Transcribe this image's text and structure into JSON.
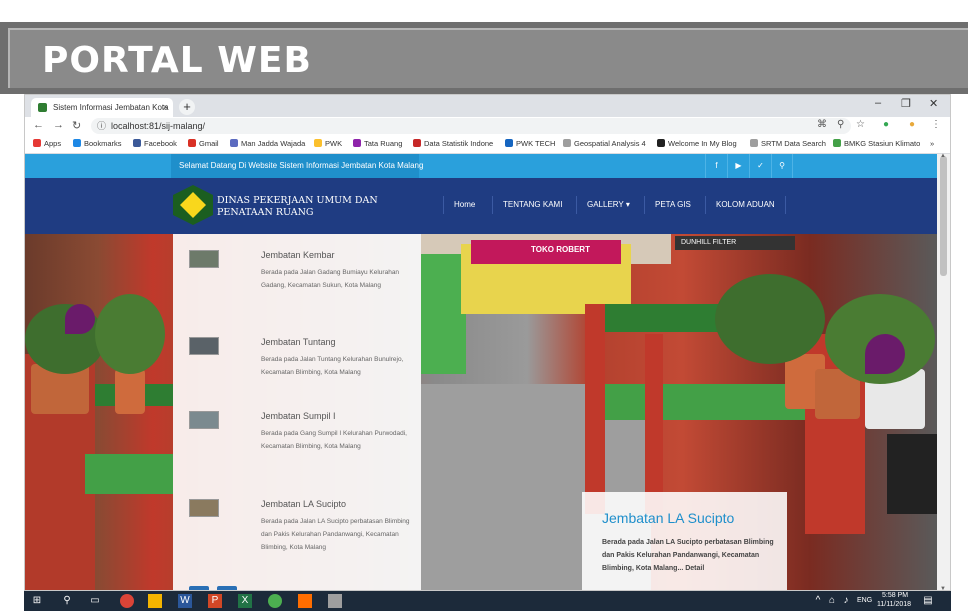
{
  "slide": {
    "title": "PORTAL WEB"
  },
  "browser": {
    "tab_title": "Sistem Informasi Jembatan Kota",
    "tab_close": "×",
    "new_tab": "+",
    "win_minimize": "–",
    "win_maximize": "❐",
    "win_close": "✕",
    "url": "localhost:81/sij-malang/",
    "bookmarks": [
      "Apps",
      "Bookmarks",
      "Facebook",
      "Gmail",
      "Man Jadda Wajada",
      "PWK",
      "Tata Ruang",
      "Data Statistik Indone",
      "PWK TECH",
      "Geospatial Analysis 4",
      "Welcome In My Blog",
      "SRTM Data Search",
      "BMKG Stasiun Klimato"
    ],
    "bookmarks_more": "»"
  },
  "site": {
    "welcome_text": "Selamat Datang Di Website Sistem Informasi Jembatan Kota Malang",
    "social_icons": [
      "facebook-icon",
      "youtube-icon",
      "twitter-icon",
      "search-icon"
    ],
    "org_name": "DINAS PEKERJAAN UMUM DAN PENATAAN RUANG",
    "menu": [
      "Home",
      "TENTANG KAMI",
      "GALLERY ▾",
      "PETA GIS",
      "KOLOM ADUAN"
    ],
    "bridges": [
      {
        "title": "Jembatan Kembar",
        "desc": "Berada pada Jalan Gadang Bumiayu Kelurahan Gadang, Kecamatan Sukun, Kota Malang"
      },
      {
        "title": "Jembatan Tuntang",
        "desc": "Berada pada Jalan Tuntang Kelurahan Bunulrejo, Kecamatan Blimbing, Kota Malang"
      },
      {
        "title": "Jembatan Sumpil I",
        "desc": "Berada pada Gang Sumpil I Kelurahan Purwodadi, Kecamatan Blimbing, Kota Malang"
      },
      {
        "title": "Jembatan LA Sucipto",
        "desc": "Berada pada Jalan LA Sucipto perbatasan Blimbing dan Pakis Kelurahan Pandanwangi, Kecamatan Blimbing, Kota Malang"
      }
    ],
    "caption": {
      "title": "Jembatan LA Sucipto",
      "desc": "Berada pada Jalan LA Sucipto perbatasan Blimbing dan Pakis Kelurahan Pandanwangi, Kecamatan Blimbing, Kota Malang... Detail"
    },
    "photo_sign": "TOKO ROBERT",
    "photo_sign_right": "DUNHILL FILTER"
  },
  "taskbar": {
    "lang": "ENG",
    "time": "5:58 PM",
    "date": "11/11/2018"
  },
  "colors": {
    "topbar": "#2aa0dc",
    "header": "#1f3c82",
    "caption_title": "#1f8fcb"
  }
}
